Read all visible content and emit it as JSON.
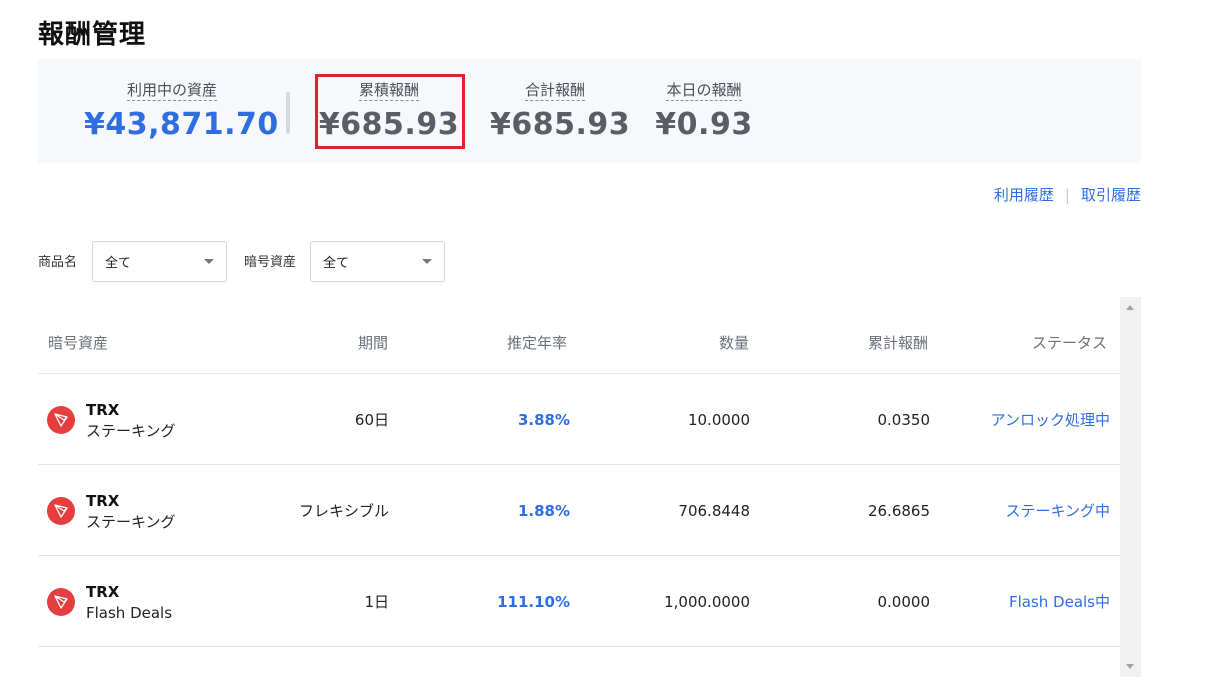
{
  "page": {
    "title": "報酬管理"
  },
  "summary": {
    "assets_in_use": {
      "label": "利用中の資産",
      "value": "¥43,871.70"
    },
    "cumulative_reward": {
      "label": "累積報酬",
      "value": "¥685.93"
    },
    "total_reward": {
      "label": "合計報酬",
      "value": "¥685.93"
    },
    "today_reward": {
      "label": "本日の報酬",
      "value": "¥0.93"
    }
  },
  "history_links": {
    "usage": "利用履歴",
    "trade": "取引履歴"
  },
  "filters": {
    "product": {
      "label": "商品名",
      "value": "全て"
    },
    "crypto": {
      "label": "暗号資産",
      "value": "全て"
    }
  },
  "table": {
    "headers": {
      "asset": "暗号資産",
      "period": "期間",
      "apr": "推定年率",
      "amount": "数量",
      "cumulative": "累計報酬",
      "status": "ステータス"
    },
    "rows": [
      {
        "coin": "TRX",
        "type": "ステーキング",
        "period": "60日",
        "apr": "3.88%",
        "amount": "10.0000",
        "cumulative": "0.0350",
        "status": "アンロック処理中",
        "icon": "tron-icon"
      },
      {
        "coin": "TRX",
        "type": "ステーキング",
        "period": "フレキシブル",
        "apr": "1.88%",
        "amount": "706.8448",
        "cumulative": "26.6865",
        "status": "ステーキング中",
        "icon": "tron-icon"
      },
      {
        "coin": "TRX",
        "type": "Flash Deals",
        "period": "1日",
        "apr": "111.10%",
        "amount": "1,000.0000",
        "cumulative": "0.0000",
        "status": "Flash Deals中",
        "icon": "tron-icon"
      }
    ]
  },
  "colors": {
    "accent": "#2f6ee0",
    "highlight": "#e1222b",
    "tron": "#e53e3e"
  }
}
